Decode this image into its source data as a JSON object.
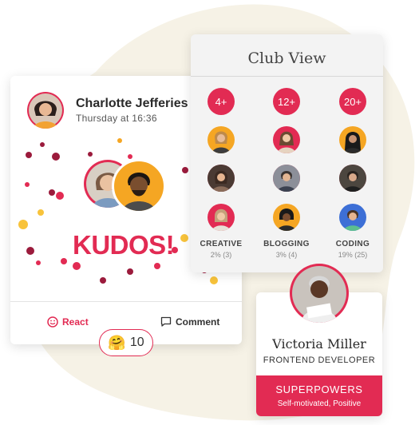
{
  "post": {
    "author_name": "Charlotte Jefferies",
    "timestamp": "Thursday at 16:36",
    "kudos_label": "KUDOS!",
    "react_label": "React",
    "comment_label": "Comment",
    "reaction_emoji": "🤗",
    "reaction_count": "10",
    "icons": [
      "smile-icon",
      "comment-icon"
    ]
  },
  "club": {
    "title": "Club View",
    "columns": [
      {
        "count": "4+",
        "name": "CREATIVE",
        "stat": "2% (3)"
      },
      {
        "count": "12+",
        "name": "BLOGGING",
        "stat": "3% (4)"
      },
      {
        "count": "20+",
        "name": "CODING",
        "stat": "19% (25)"
      }
    ]
  },
  "profile": {
    "name": "Victoria Miller",
    "role": "FRONTEND DEVELOPER",
    "superpowers_label": "SUPERPOWERS",
    "superpowers": "Self-motivated, Positive"
  },
  "colors": {
    "accent": "#e22b53",
    "orange": "#f5a623",
    "maroon": "#9b1b3c",
    "yellow": "#f8c33b",
    "blob": "#f6f2e6"
  }
}
